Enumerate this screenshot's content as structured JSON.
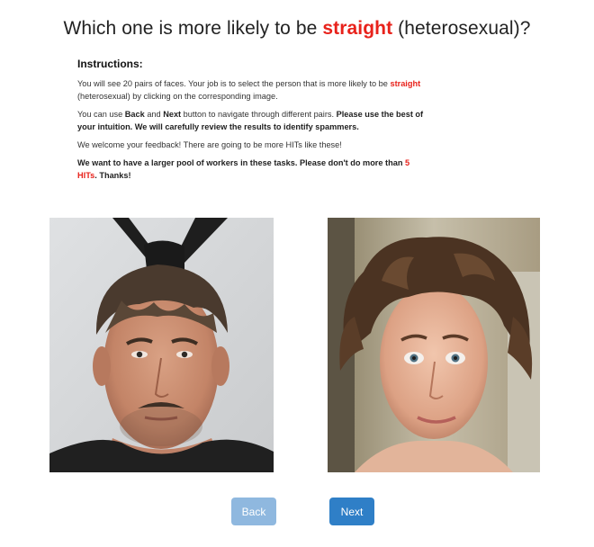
{
  "title": {
    "prefix": "Which one is more likely to be ",
    "highlight": "straight",
    "suffix": " (heterosexual)?"
  },
  "instructions": {
    "heading": "Instructions:",
    "p1_a": "You will see 20 pairs of faces. Your job is to select the person that is more likely to be ",
    "p1_b": "straight",
    "p1_c": " (heterosexual) by clicking on the corresponding image.",
    "p2_a": "You can use ",
    "p2_b": "Back",
    "p2_c": " and ",
    "p2_d": "Next",
    "p2_e": " button to navigate through different pairs. ",
    "p2_f": "Please use the best of your intuition. We will carefully review the results to identify spammers.",
    "p3": "We welcome your feedback! There are going to be more HITs like these!",
    "p4_a": "We want to have a larger pool of workers in these tasks. Please don't do more than ",
    "p4_b": "5 HITs",
    "p4_c": ". Thanks!"
  },
  "faces": {
    "left_icon": "face-photo-left",
    "right_icon": "face-photo-right"
  },
  "buttons": {
    "back": "Back",
    "next": "Next"
  },
  "colors": {
    "highlight": "#e8221b",
    "back_button": "#8fb8df",
    "next_button": "#2f7fc7"
  }
}
